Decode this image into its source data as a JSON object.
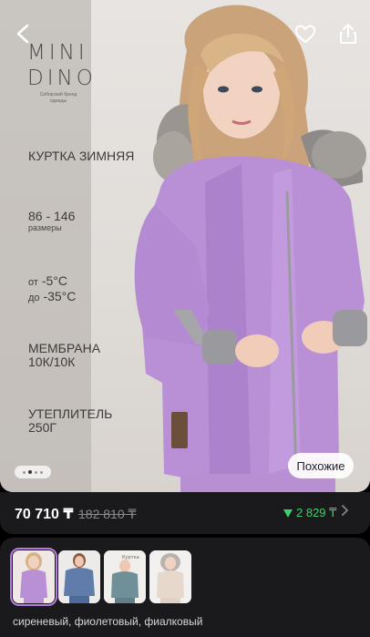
{
  "product": {
    "brand_line1": "MINI",
    "brand_line2": "DINO",
    "brand_tagline_1": "Сибирский бренд",
    "brand_tagline_2": "одежды",
    "title": "КУРТКА ЗИМНЯЯ",
    "sizes": "86 - 146",
    "sizes_label": "размеры",
    "temp_from_prefix": "от",
    "temp_from": "-5°C",
    "temp_to_prefix": "до",
    "temp_to": "-35°C",
    "membrane_1": "МЕМБРАНА",
    "membrane_2": "10К/10К",
    "insulation_1": "УТЕПЛИТЕЛЬ",
    "insulation_2": "250Г"
  },
  "actions": {
    "similar_label": "Похожие"
  },
  "gallery": {
    "dots_total": 4,
    "dots_active": 2
  },
  "price": {
    "current": "70 710 ₸",
    "old": "182 810 ₸",
    "bonus": "2 829 ₸",
    "bonus_color": "#3ecf6a"
  },
  "variants": {
    "label": "сиреневый, фиолетовый, фиалковый",
    "thumbs": [
      {
        "color": "lilac",
        "selected": true
      },
      {
        "color": "blue",
        "selected": false
      },
      {
        "color": "teal",
        "selected": false
      },
      {
        "color": "beige",
        "selected": false
      }
    ],
    "selected_outline": "#b57be0"
  },
  "icons": {
    "back": "back-arrow-icon",
    "favorite": "heart-icon",
    "share": "share-icon",
    "bonus_arrow": "triangle-down-icon",
    "chevron": "chevron-right-icon"
  }
}
